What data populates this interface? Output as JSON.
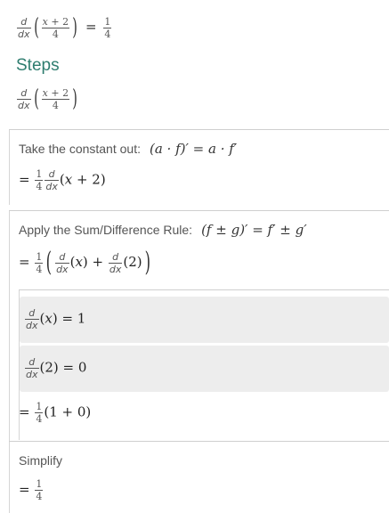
{
  "problem": {
    "variable": "x",
    "constant": "2",
    "denominator": "4",
    "result_num": "1",
    "result_den": "4"
  },
  "steps_title": "Steps",
  "deriv": {
    "d": "d",
    "dx": "dx"
  },
  "step1": {
    "label": "Take the constant out:",
    "rule": "(a · f)′ = a · f′"
  },
  "step2": {
    "label": "Apply the Sum/Difference Rule:",
    "rule": "(f ± g)′ = f′ ± g′"
  },
  "sub1": {
    "value": "1"
  },
  "sub2": {
    "value": "0"
  },
  "combine": {
    "a": "1",
    "b": "0"
  },
  "step3": {
    "label": "Simplify"
  }
}
